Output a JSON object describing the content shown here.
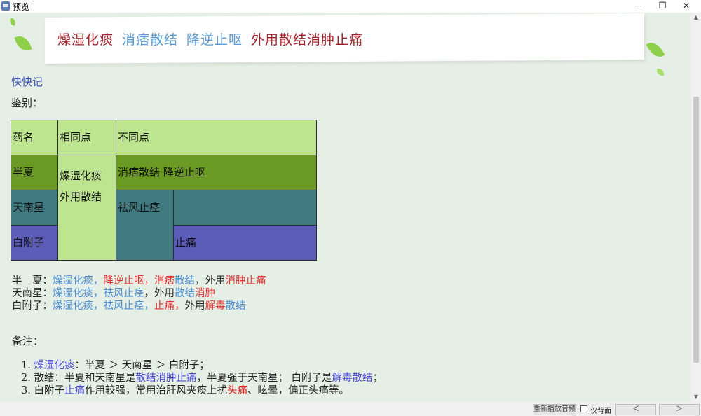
{
  "window": {
    "title": "预览",
    "minimize": "—",
    "restore": "❐",
    "close": "✕"
  },
  "banner": {
    "parts": [
      {
        "text": "燥湿化痰",
        "color": "#a2232a"
      },
      {
        "text": "消痞散结",
        "color": "#5b9bd5"
      },
      {
        "text": "降逆止呕",
        "color": "#5b9bd5"
      },
      {
        "text": "外用散结消肿止痛",
        "color": "#a2232a"
      }
    ]
  },
  "mnemonic_label": "快快记",
  "compare_label": "鉴别：",
  "table": {
    "headers": [
      "药名",
      "相同点",
      "不同点"
    ],
    "common": [
      "燥湿化痰",
      "外用散结"
    ],
    "rows": [
      {
        "name": "半夏",
        "diff": "消痞散结 降逆止呕"
      },
      {
        "name": "天南星",
        "diff": "祛风止痉"
      },
      {
        "name": "白附子",
        "diff": "止痛"
      }
    ],
    "colors": {
      "header": "#bde58f",
      "row1": "#6b9a24",
      "row2": "#3e7a80",
      "row3": "#5a5cb8"
    }
  },
  "summary": [
    [
      {
        "t": "半　夏：",
        "c": ""
      },
      {
        "t": "燥湿化痰，",
        "c": "blue"
      },
      {
        "t": "降逆止呕，",
        "c": "red"
      },
      {
        "t": "消痞",
        "c": "red"
      },
      {
        "t": "散结",
        "c": "blue"
      },
      {
        "t": "，外用",
        "c": ""
      },
      {
        "t": "消肿止痛",
        "c": "red"
      }
    ],
    [
      {
        "t": "天南星：",
        "c": ""
      },
      {
        "t": "燥湿化痰，",
        "c": "blue"
      },
      {
        "t": "祛风止痉",
        "c": "blue"
      },
      {
        "t": "，外用",
        "c": ""
      },
      {
        "t": "散结",
        "c": "blue"
      },
      {
        "t": "消肿",
        "c": "red"
      }
    ],
    [
      {
        "t": "白附子：",
        "c": ""
      },
      {
        "t": "燥湿化痰，",
        "c": "blue"
      },
      {
        "t": "祛风止痉，",
        "c": "blue"
      },
      {
        "t": "止痛，",
        "c": "red"
      },
      {
        "t": "外用",
        "c": ""
      },
      {
        "t": "解毒",
        "c": "red"
      },
      {
        "t": "散结",
        "c": "blue"
      }
    ]
  ],
  "notes_label": "备注：",
  "notes": [
    [
      {
        "t": "1. ",
        "c": ""
      },
      {
        "t": "燥湿化痰",
        "c": "ind"
      },
      {
        "t": "：半夏 ＞ 天南星 ＞ 白附子；",
        "c": ""
      }
    ],
    [
      {
        "t": "2. 散结：半夏和天南星是",
        "c": ""
      },
      {
        "t": "散结消肿止痛",
        "c": "ind"
      },
      {
        "t": "，半夏强于天南星；  白附子是",
        "c": ""
      },
      {
        "t": "解毒散结",
        "c": "ind"
      },
      {
        "t": "；",
        "c": ""
      }
    ],
    [
      {
        "t": "3. 白附子",
        "c": ""
      },
      {
        "t": "止痛",
        "c": "ind"
      },
      {
        "t": "作用较强，常用治肝风夹痰上扰",
        "c": ""
      },
      {
        "t": "头痛",
        "c": "dred"
      },
      {
        "t": "、眩晕，偏正头痛等。",
        "c": ""
      }
    ]
  ],
  "bottombar": {
    "replay": "重新播放音频",
    "back_only": "仅背面",
    "prev": "＜",
    "next": "＞"
  }
}
